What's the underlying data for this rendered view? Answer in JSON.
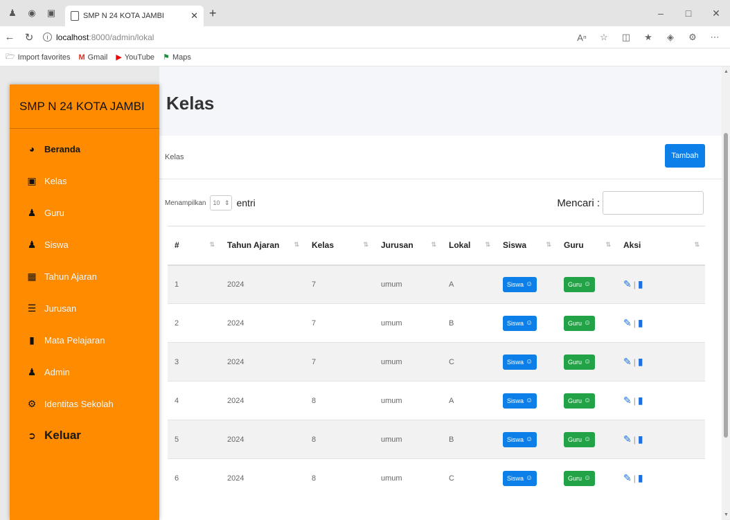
{
  "browser": {
    "tab_title": "SMP N 24 KOTA JAMBI",
    "url_host": "localhost",
    "url_path": ":8000/admin/lokal",
    "bookmarks": [
      {
        "label": "Import favorites",
        "icon": "folder-icon"
      },
      {
        "label": "Gmail",
        "icon": "gmail-icon"
      },
      {
        "label": "YouTube",
        "icon": "youtube-icon"
      },
      {
        "label": "Maps",
        "icon": "maps-icon"
      }
    ]
  },
  "sidebar": {
    "brand": "SMP N 24 KOTA JAMBI",
    "items": [
      {
        "label": "Beranda",
        "icon": "dashboard-icon"
      },
      {
        "label": "Kelas",
        "icon": "classroom-icon"
      },
      {
        "label": "Guru",
        "icon": "user-icon"
      },
      {
        "label": "Siswa",
        "icon": "user-icon"
      },
      {
        "label": "Tahun Ajaran",
        "icon": "calendar-icon"
      },
      {
        "label": "Jurusan",
        "icon": "list-icon"
      },
      {
        "label": "Mata Pelajaran",
        "icon": "book-icon"
      },
      {
        "label": "Admin",
        "icon": "user-icon"
      },
      {
        "label": "Identitas Sekolah",
        "icon": "gear-icon"
      },
      {
        "label": "Keluar",
        "icon": "logout-icon"
      }
    ]
  },
  "main": {
    "page_title": "Kelas",
    "card_title": "Kelas",
    "add_button": "Tambah",
    "length_label": "Menampilkan",
    "length_value": "10",
    "length_suffix": "entri",
    "search_label": "Mencari :",
    "columns": [
      "#",
      "Tahun Ajaran",
      "Kelas",
      "Jurusan",
      "Lokal",
      "Siswa",
      "Guru",
      "Aksi"
    ],
    "rows": [
      {
        "no": "1",
        "tahun": "2024",
        "kelas": "7",
        "jurusan": "umum",
        "lokal": "A"
      },
      {
        "no": "2",
        "tahun": "2024",
        "kelas": "7",
        "jurusan": "umum",
        "lokal": "B"
      },
      {
        "no": "3",
        "tahun": "2024",
        "kelas": "7",
        "jurusan": "umum",
        "lokal": "C"
      },
      {
        "no": "4",
        "tahun": "2024",
        "kelas": "8",
        "jurusan": "umum",
        "lokal": "A"
      },
      {
        "no": "5",
        "tahun": "2024",
        "kelas": "8",
        "jurusan": "umum",
        "lokal": "B"
      },
      {
        "no": "6",
        "tahun": "2024",
        "kelas": "8",
        "jurusan": "umum",
        "lokal": "C"
      }
    ],
    "siswa_button": "Siswa",
    "guru_button": "Guru"
  },
  "colors": {
    "sidebar": "#ff8c00",
    "primary": "#0d7fe8",
    "success": "#23a348"
  }
}
